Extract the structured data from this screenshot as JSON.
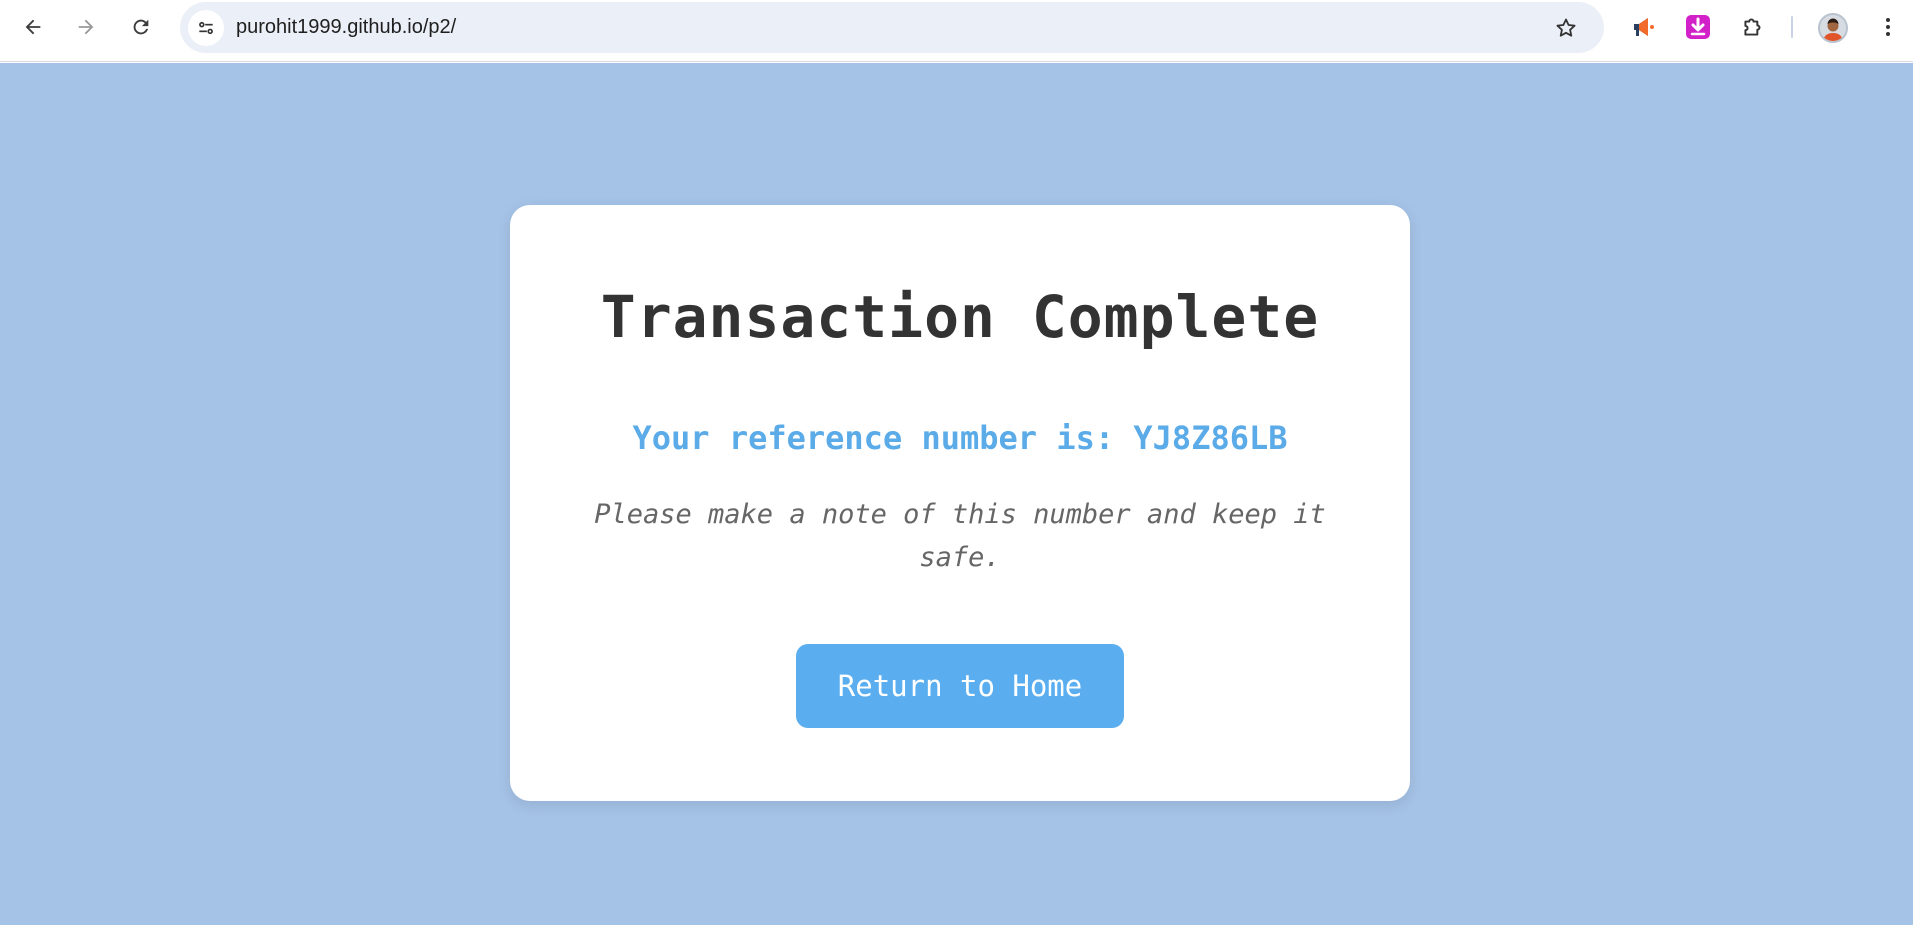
{
  "browser": {
    "url": "purohit1999.github.io/p2/",
    "icons": {
      "back": "back-arrow-icon",
      "forward": "forward-arrow-icon",
      "reload": "reload-icon",
      "site_info": "tune-icon",
      "bookmark": "star-icon",
      "extension_1": "megaphone-icon",
      "extension_2": "download-icon",
      "extensions_menu": "puzzle-icon",
      "profile": "avatar",
      "menu": "more-vert-icon"
    }
  },
  "page": {
    "title": "Transaction Complete",
    "reference_text": "Your reference number is: YJ8Z86LB",
    "note": "Please make a note of this number and keep it safe.",
    "return_button": "Return to Home"
  },
  "colors": {
    "background": "#a5c3e7",
    "card": "#ffffff",
    "accent": "#5aabe8",
    "button": "#5aaef0",
    "title": "#333333",
    "note": "#666666"
  }
}
